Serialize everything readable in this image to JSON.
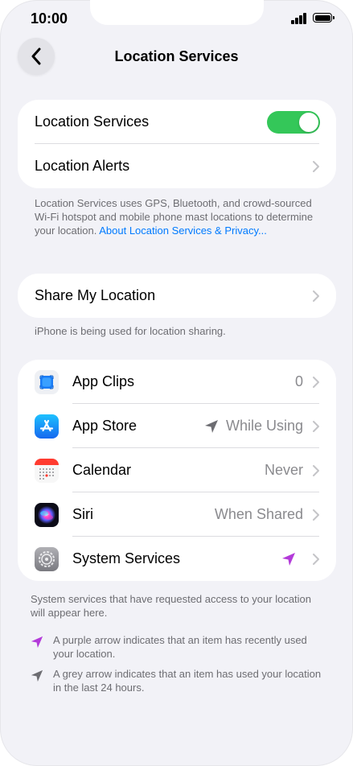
{
  "status_bar": {
    "time": "10:00"
  },
  "nav": {
    "title": "Location Services"
  },
  "location_card": {
    "services_label": "Location Services",
    "services_on": true,
    "alerts_label": "Location Alerts"
  },
  "location_footer": {
    "text": "Location Services uses GPS, Bluetooth, and crowd-sourced Wi-Fi hotspot and mobile phone mast locations to determine your location.",
    "link": "About Location Services & Privacy..."
  },
  "share_card": {
    "label": "Share My Location"
  },
  "share_footer": "iPhone is being used for location sharing.",
  "apps": [
    {
      "name": "App Clips",
      "value": "0",
      "icon": "app-clips-icon"
    },
    {
      "name": "App Store",
      "value": "While Using",
      "icon": "app-store-icon",
      "arrow": "grey"
    },
    {
      "name": "Calendar",
      "value": "Never",
      "icon": "calendar-icon"
    },
    {
      "name": "Siri",
      "value": "When Shared",
      "icon": "siri-icon"
    },
    {
      "name": "System Services",
      "value": "",
      "icon": "system-services-icon",
      "arrow": "purple"
    }
  ],
  "apps_footer": "System services that have requested access to your location will appear here.",
  "legend": {
    "purple": "A purple arrow indicates that an item has recently used your location.",
    "grey": "A grey arrow indicates that an item has used your location in the last 24 hours."
  },
  "colors": {
    "toggle_on": "#34c759",
    "link": "#007aff",
    "purple_arrow": "#b33ad9",
    "grey_arrow": "#6d6d72"
  }
}
